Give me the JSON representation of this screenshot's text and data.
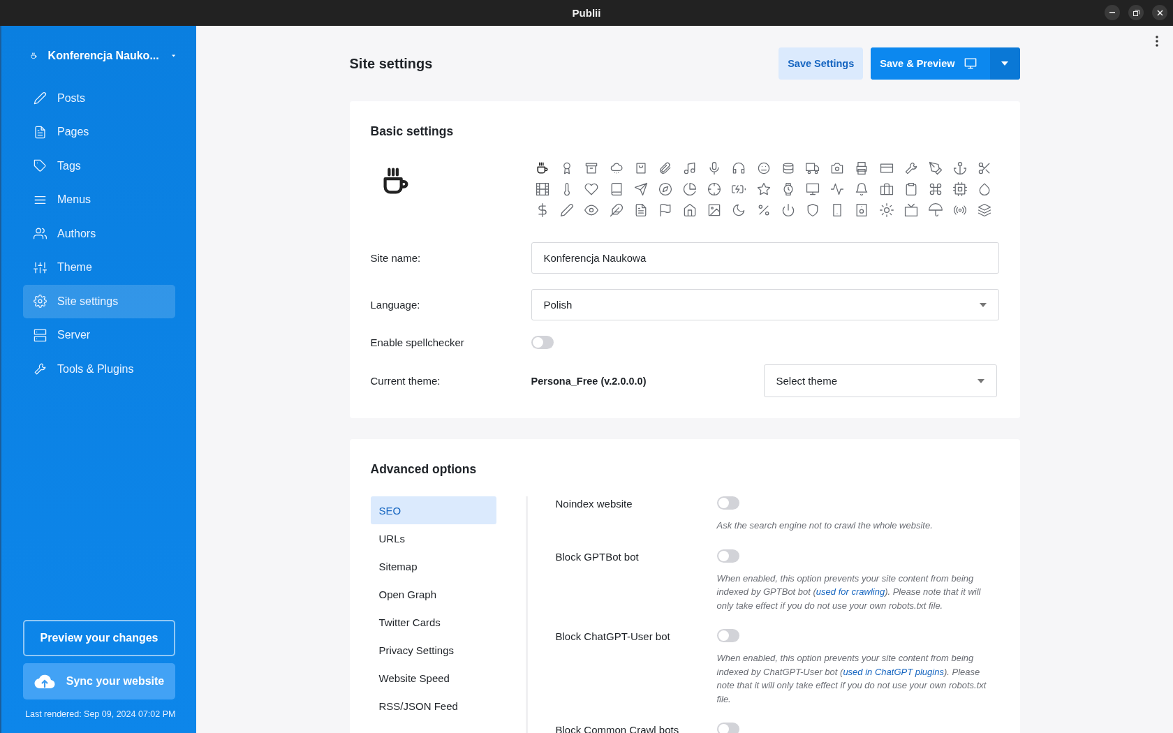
{
  "window": {
    "title": "Publii"
  },
  "sidebar": {
    "site_name": "Konferencja Nauko...",
    "items": [
      {
        "kind": "pencil",
        "label": "Posts",
        "selected": false
      },
      {
        "kind": "document",
        "label": "Pages",
        "selected": false
      },
      {
        "kind": "tag",
        "label": "Tags",
        "selected": false
      },
      {
        "kind": "menu",
        "label": "Menus",
        "selected": false
      },
      {
        "kind": "users",
        "label": "Authors",
        "selected": false
      },
      {
        "kind": "sliders",
        "label": "Theme",
        "selected": false
      },
      {
        "kind": "gear",
        "label": "Site settings",
        "selected": true
      },
      {
        "kind": "server",
        "label": "Server",
        "selected": false
      },
      {
        "kind": "wrench",
        "label": "Tools & Plugins",
        "selected": false
      }
    ],
    "preview_button": "Preview your changes",
    "sync_button": "Sync your website",
    "last_rendered": "Last rendered: Sep 09, 2024 07:02 PM"
  },
  "header": {
    "title": "Site settings",
    "save_button": "Save Settings",
    "save_preview_button": "Save & Preview"
  },
  "basic": {
    "title": "Basic settings",
    "icons": [
      {
        "kind": "cup",
        "selected": true
      },
      {
        "kind": "ribbon",
        "selected": false
      },
      {
        "kind": "archive",
        "selected": false
      },
      {
        "kind": "cloud",
        "selected": false
      },
      {
        "kind": "bag",
        "selected": false
      },
      {
        "kind": "paperclip",
        "selected": false
      },
      {
        "kind": "music",
        "selected": false
      },
      {
        "kind": "microphone",
        "selected": false
      },
      {
        "kind": "headphones",
        "selected": false
      },
      {
        "kind": "face",
        "selected": false
      },
      {
        "kind": "database",
        "selected": false
      },
      {
        "kind": "truck",
        "selected": false
      },
      {
        "kind": "camera",
        "selected": false
      },
      {
        "kind": "printer",
        "selected": false
      },
      {
        "kind": "card",
        "selected": false
      },
      {
        "kind": "wrench",
        "selected": false
      },
      {
        "kind": "pen",
        "selected": false
      },
      {
        "kind": "anchor",
        "selected": false
      },
      {
        "kind": "scissors",
        "selected": false
      },
      {
        "kind": "film",
        "selected": false
      },
      {
        "kind": "thermometer",
        "selected": false
      },
      {
        "kind": "heart",
        "selected": false
      },
      {
        "kind": "book",
        "selected": false
      },
      {
        "kind": "send",
        "selected": false
      },
      {
        "kind": "compass",
        "selected": false
      },
      {
        "kind": "piechart",
        "selected": false
      },
      {
        "kind": "crosshair",
        "selected": false
      },
      {
        "kind": "battery",
        "selected": false
      },
      {
        "kind": "star",
        "selected": false
      },
      {
        "kind": "watch",
        "selected": false
      },
      {
        "kind": "monitor",
        "selected": false
      },
      {
        "kind": "pulse",
        "selected": false
      },
      {
        "kind": "bell",
        "selected": false
      },
      {
        "kind": "briefcase",
        "selected": false
      },
      {
        "kind": "clipboard",
        "selected": false
      },
      {
        "kind": "command",
        "selected": false
      },
      {
        "kind": "chip",
        "selected": false
      },
      {
        "kind": "droplet",
        "selected": false
      },
      {
        "kind": "dollar",
        "selected": false
      },
      {
        "kind": "pencil",
        "selected": false
      },
      {
        "kind": "eye",
        "selected": false
      },
      {
        "kind": "feather",
        "selected": false
      },
      {
        "kind": "document",
        "selected": false
      },
      {
        "kind": "flag",
        "selected": false
      },
      {
        "kind": "house",
        "selected": false
      },
      {
        "kind": "image",
        "selected": false
      },
      {
        "kind": "moon",
        "selected": false
      },
      {
        "kind": "percent",
        "selected": false
      },
      {
        "kind": "power",
        "selected": false
      },
      {
        "kind": "shield",
        "selected": false
      },
      {
        "kind": "tablet",
        "selected": false
      },
      {
        "kind": "speaker",
        "selected": false
      },
      {
        "kind": "sun",
        "selected": false
      },
      {
        "kind": "tv",
        "selected": false
      },
      {
        "kind": "umbrella",
        "selected": false
      },
      {
        "kind": "broadcast",
        "selected": false
      },
      {
        "kind": "layers",
        "selected": false
      }
    ],
    "site_name": {
      "label": "Site name:",
      "value": "Konferencja Naukowa"
    },
    "language": {
      "label": "Language:",
      "value": "Polish"
    },
    "spellchecker": {
      "label": "Enable spellchecker",
      "on": false
    },
    "theme": {
      "label": "Current theme:",
      "name": "Persona_Free (v.2.0.0.0)",
      "select": "Select theme"
    }
  },
  "advanced": {
    "title": "Advanced options",
    "tabs": [
      {
        "label": "SEO",
        "selected": true
      },
      {
        "label": "URLs",
        "selected": false
      },
      {
        "label": "Sitemap",
        "selected": false
      },
      {
        "label": "Open Graph",
        "selected": false
      },
      {
        "label": "Twitter Cards",
        "selected": false
      },
      {
        "label": "Privacy Settings",
        "selected": false
      },
      {
        "label": "Website Speed",
        "selected": false
      },
      {
        "label": "RSS/JSON Feed",
        "selected": false
      }
    ],
    "options": [
      {
        "label": "Noindex website",
        "on": false,
        "description": "Ask the search engine not to crawl the whole website."
      },
      {
        "label": "Block GPTBot bot",
        "on": false,
        "description": "When enabled, this option prevents your site content from being indexed by GPTBot bot (",
        "link": "used for crawling",
        "description_after": "). Please note that it will only take effect if you do not use your own robots.txt file."
      },
      {
        "label": "Block ChatGPT-User bot",
        "on": false,
        "description": "When enabled, this option prevents your site content from being indexed by ChatGPT-User bot (",
        "link": "used in ChatGPT plugins",
        "description_after": "). Please note that it will only take effect if you do not use your own robots.txt file."
      },
      {
        "label": "Block Common Crawl bots",
        "on": false
      }
    ]
  }
}
